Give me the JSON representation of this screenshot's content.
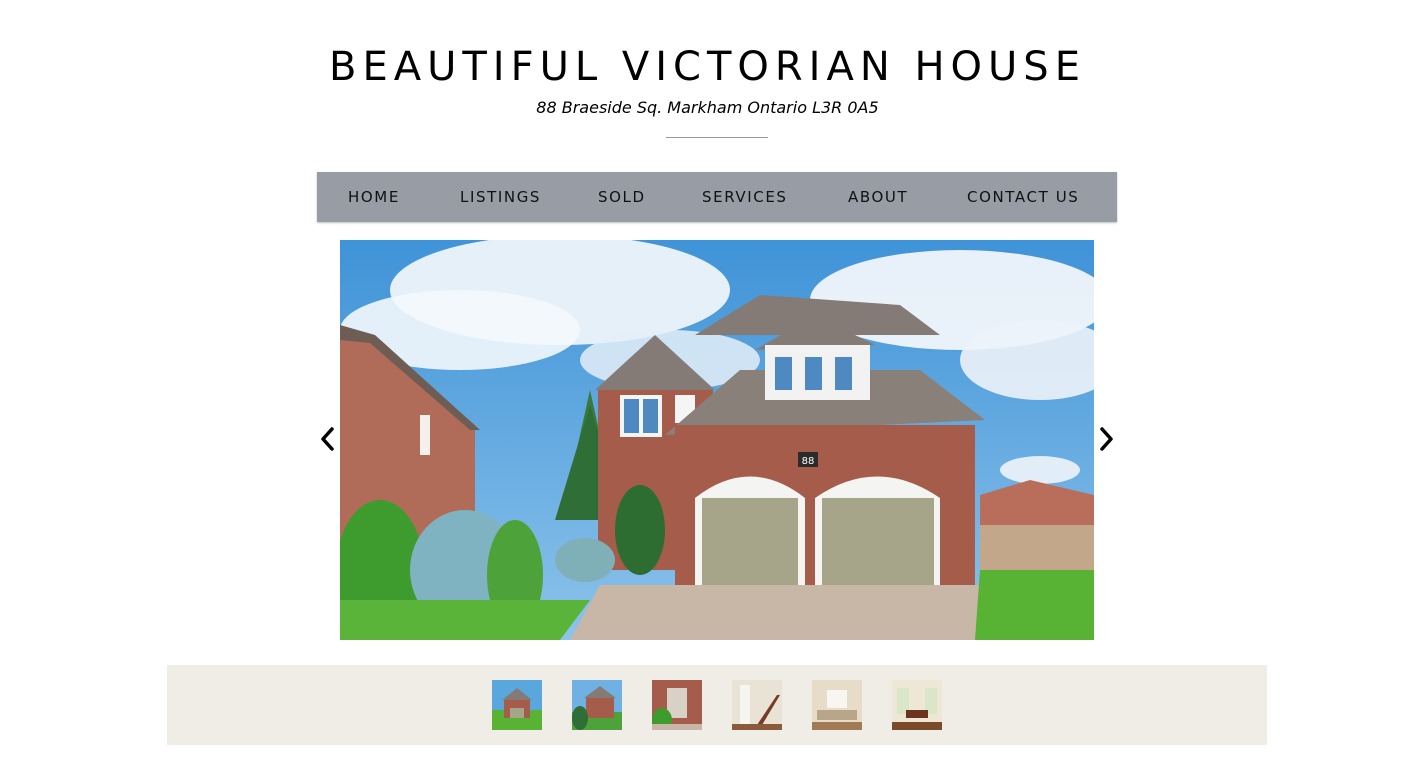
{
  "header": {
    "title": "BEAUTIFUL VICTORIAN HOUSE",
    "address": "88 Braeside Sq. Markham Ontario L3R 0A5"
  },
  "nav": {
    "items": [
      {
        "label": "HOME"
      },
      {
        "label": "LISTINGS"
      },
      {
        "label": "SOLD"
      },
      {
        "label": "SERVICES"
      },
      {
        "label": "ABOUT"
      },
      {
        "label": "CONTACT US"
      }
    ]
  },
  "slider": {
    "house_number": "88",
    "prev_icon": "chevron-left-icon",
    "next_icon": "chevron-right-icon",
    "thumbnail_count": 6
  },
  "colors": {
    "nav_background": "#979ca5",
    "thumbnail_bar": "#f0ede6",
    "sky": "#5aa7de",
    "brick": "#a65c4a",
    "garage_door": "#a6a58a",
    "grass": "#58b233"
  }
}
